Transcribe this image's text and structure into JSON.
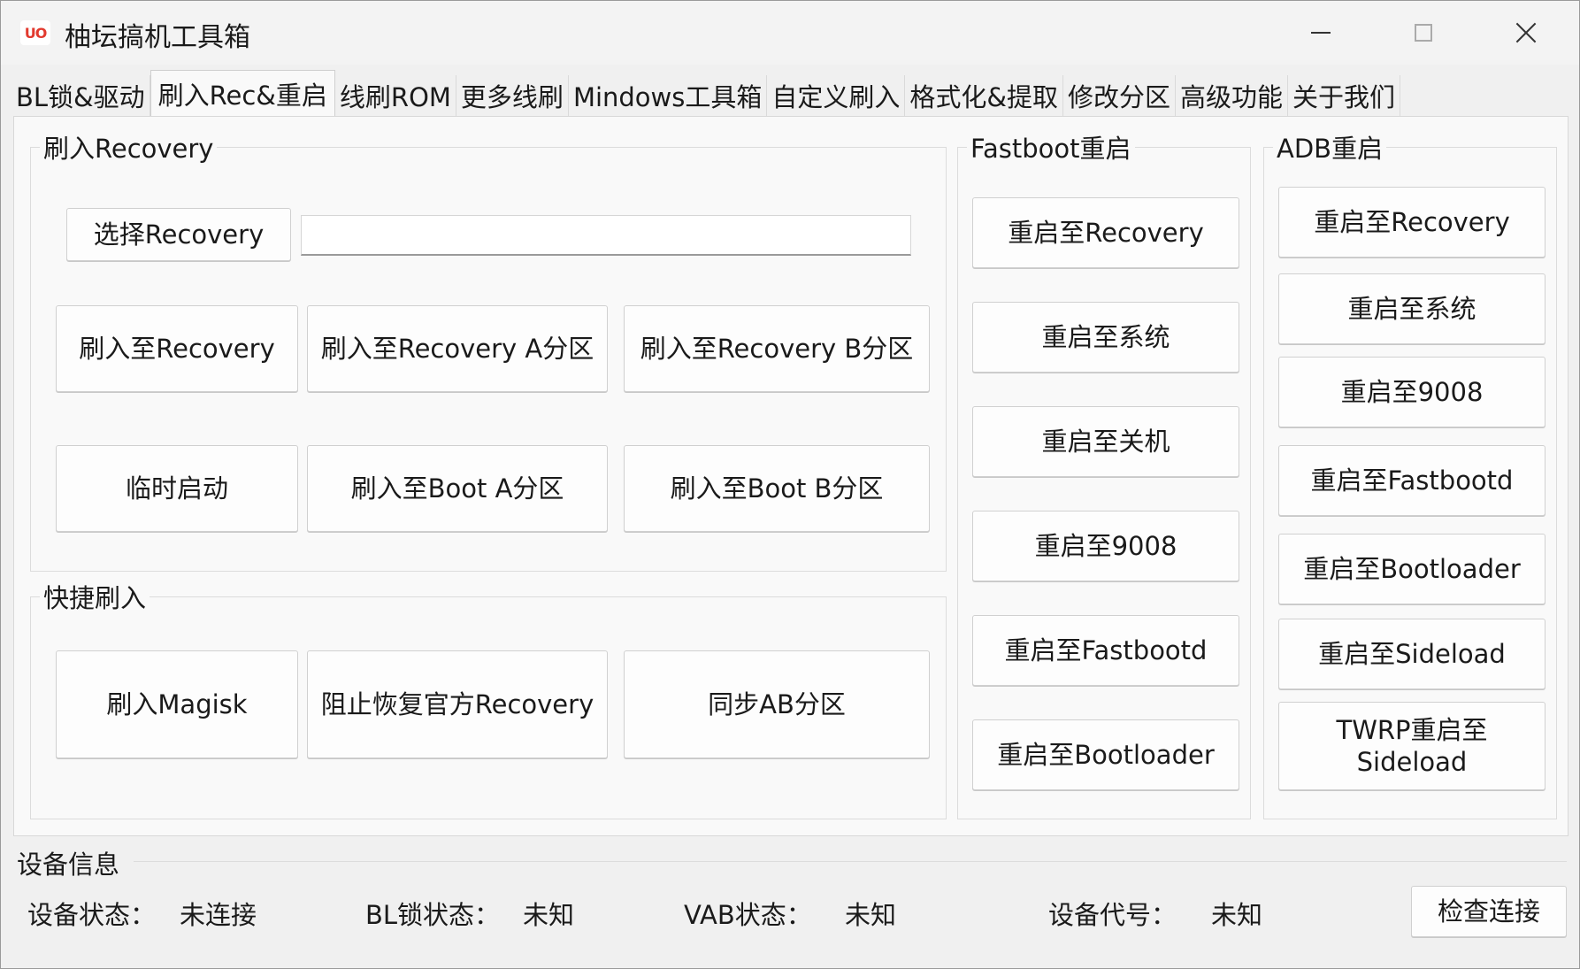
{
  "window": {
    "title": "柚坛搞机工具箱",
    "icon_text": "UO"
  },
  "tabs": [
    {
      "label": "BL锁&驱动"
    },
    {
      "label": "刷入Rec&重启",
      "active": true
    },
    {
      "label": "线刷ROM"
    },
    {
      "label": "更多线刷"
    },
    {
      "label": "Mindows工具箱"
    },
    {
      "label": "自定义刷入"
    },
    {
      "label": "格式化&提取"
    },
    {
      "label": "修改分区"
    },
    {
      "label": "高级功能"
    },
    {
      "label": "关于我们"
    }
  ],
  "flash_recovery": {
    "title": "刷入Recovery",
    "select_button": "选择Recovery",
    "path_value": "",
    "flash_to_recovery": "刷入至Recovery",
    "flash_to_recovery_a": "刷入至Recovery A分区",
    "flash_to_recovery_b": "刷入至Recovery B分区",
    "temp_boot": "临时启动",
    "flash_to_boot_a": "刷入至Boot A分区",
    "flash_to_boot_b": "刷入至Boot B分区"
  },
  "quick_flash": {
    "title": "快捷刷入",
    "flash_magisk": "刷入Magisk",
    "block_official_recovery": "阻止恢复官方Recovery",
    "sync_ab": "同步AB分区"
  },
  "fastboot_reboot": {
    "title": "Fastboot重启",
    "buttons": [
      "重启至Recovery",
      "重启至系统",
      "重启至关机",
      "重启至9008",
      "重启至Fastbootd",
      "重启至Bootloader"
    ]
  },
  "adb_reboot": {
    "title": "ADB重启",
    "buttons": [
      "重启至Recovery",
      "重启至系统",
      "重启至9008",
      "重启至Fastbootd",
      "重启至Bootloader",
      "重启至Sideload",
      "TWRP重启至 Sideload"
    ]
  },
  "device_info": {
    "title": "设备信息",
    "status_label": "设备状态：",
    "status_value": "未连接",
    "bl_label": "BL锁状态：",
    "bl_value": "未知",
    "vab_label": "VAB状态：",
    "vab_value": "未知",
    "code_label": "设备代号：",
    "code_value": "未知",
    "check_button": "检查连接"
  }
}
